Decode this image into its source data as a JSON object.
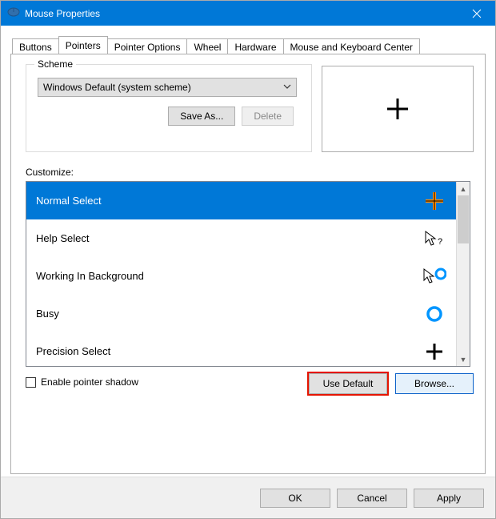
{
  "window": {
    "title": "Mouse Properties",
    "close_icon": "✕"
  },
  "tabs": [
    {
      "label": "Buttons"
    },
    {
      "label": "Pointers"
    },
    {
      "label": "Pointer Options"
    },
    {
      "label": "Wheel"
    },
    {
      "label": "Hardware"
    },
    {
      "label": "Mouse and Keyboard Center"
    }
  ],
  "active_tab_index": 1,
  "scheme": {
    "legend": "Scheme",
    "selected": "Windows Default (system scheme)",
    "save_as": "Save As...",
    "delete": "Delete"
  },
  "customize_label": "Customize:",
  "cursor_items": [
    {
      "label": "Normal Select",
      "icon": "plus-orange",
      "selected": true
    },
    {
      "label": "Help Select",
      "icon": "arrow-question",
      "selected": false
    },
    {
      "label": "Working In Background",
      "icon": "arrow-ring",
      "selected": false
    },
    {
      "label": "Busy",
      "icon": "ring",
      "selected": false
    },
    {
      "label": "Precision Select",
      "icon": "plus-black",
      "selected": false
    }
  ],
  "shadow_checkbox": {
    "label": "Enable pointer shadow",
    "checked": false
  },
  "buttons": {
    "use_default": "Use Default",
    "browse": "Browse..."
  },
  "footer": {
    "ok": "OK",
    "cancel": "Cancel",
    "apply": "Apply"
  }
}
